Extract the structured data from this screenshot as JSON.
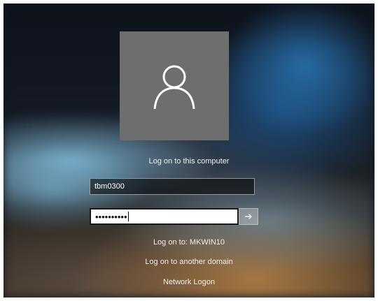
{
  "login": {
    "title": "Log on to this computer",
    "username_value": "tbm0300",
    "password_mask": "••••••••••",
    "logon_to": "Log on to: MKWIN10",
    "another_domain": "Log on to another domain",
    "network_logon": "Network Logon"
  },
  "icons": {
    "avatar": "user-icon",
    "submit": "arrow-right-icon"
  },
  "colors": {
    "avatar_tile": "#6e6e6e",
    "text": "#f2f2f2"
  }
}
